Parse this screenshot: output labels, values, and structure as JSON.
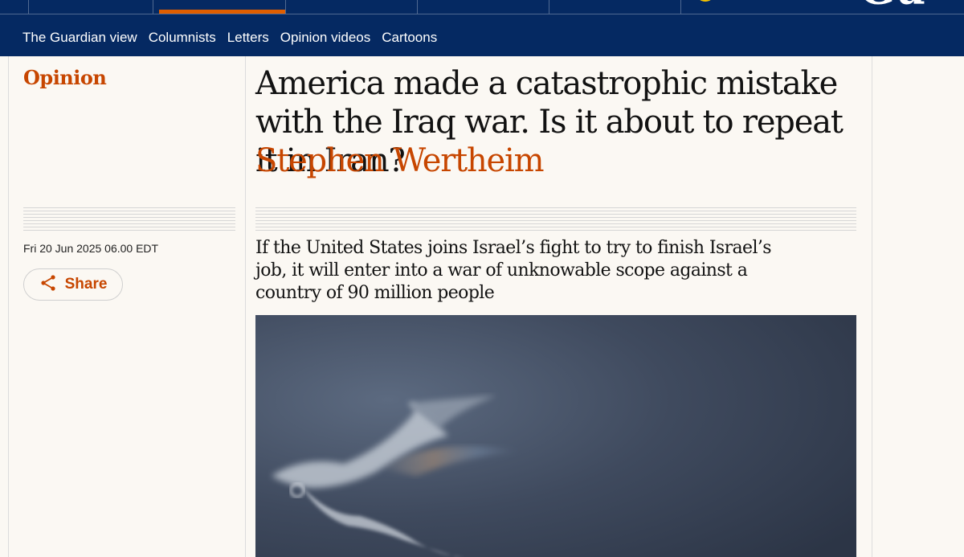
{
  "nav": {
    "sections": [
      "The Guardian view",
      "Columnists",
      "Letters",
      "Opinion videos",
      "Cartoons"
    ]
  },
  "article": {
    "section": "Opinion",
    "headline": "America made a catastrophic mistake with the Iraq war. Is it about to repeat it in Iran?",
    "byline": "Stephen Wertheim",
    "dateline": "Fri 20 Jun 2025 06.00 EDT",
    "share_label": "Share",
    "standfirst": "If the United States joins Israel’s fight to try to finish Israel’s job, it will enter into a war of unknowable scope against a country of 90 million people"
  },
  "colors": {
    "nav_bg": "#052962",
    "accent": "#c74600",
    "pillar_active": "#e05e00",
    "page_bg": "#fbf8f3"
  },
  "icons": {
    "share": "share-icon"
  }
}
